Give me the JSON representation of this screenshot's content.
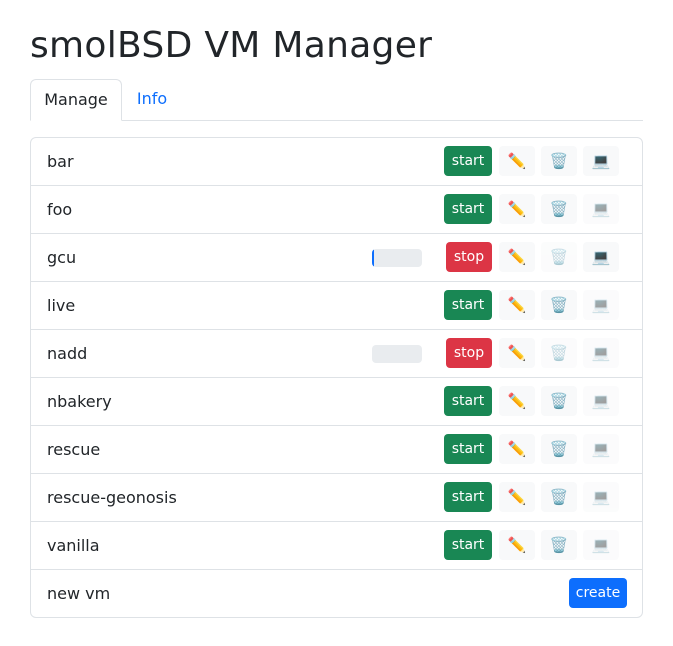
{
  "title": "smolBSD VM Manager",
  "tabs": [
    {
      "label": "Manage",
      "active": true
    },
    {
      "label": "Info",
      "active": false
    }
  ],
  "vms": [
    {
      "name": "bar",
      "action": "start",
      "progress": null,
      "console_enabled": true,
      "delete_enabled": true
    },
    {
      "name": "foo",
      "action": "start",
      "progress": null,
      "console_enabled": false,
      "delete_enabled": true
    },
    {
      "name": "gcu",
      "action": "stop",
      "progress": 0.04,
      "console_enabled": true,
      "delete_enabled": false
    },
    {
      "name": "live",
      "action": "start",
      "progress": null,
      "console_enabled": false,
      "delete_enabled": true
    },
    {
      "name": "nadd",
      "action": "stop",
      "progress": 0,
      "console_enabled": false,
      "delete_enabled": false
    },
    {
      "name": "nbakery",
      "action": "start",
      "progress": null,
      "console_enabled": false,
      "delete_enabled": true
    },
    {
      "name": "rescue",
      "action": "start",
      "progress": null,
      "console_enabled": false,
      "delete_enabled": true
    },
    {
      "name": "rescue-geonosis",
      "action": "start",
      "progress": null,
      "console_enabled": false,
      "delete_enabled": true
    },
    {
      "name": "vanilla",
      "action": "start",
      "progress": null,
      "console_enabled": false,
      "delete_enabled": true
    }
  ],
  "icons": {
    "edit": "✏️",
    "delete": "🗑️",
    "console": "💻"
  },
  "new_vm": {
    "label": "new vm",
    "button": "create"
  },
  "colors": {
    "start": "#198754",
    "stop": "#dc3545",
    "create": "#0d6efd",
    "link": "#0d6efd"
  }
}
